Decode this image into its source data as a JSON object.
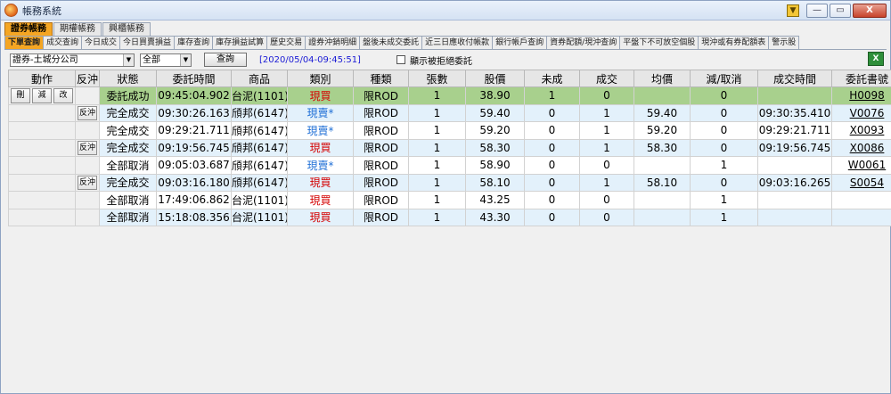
{
  "window": {
    "title": "帳務系統",
    "pin": "▼",
    "minimize": "—",
    "restore": "▭",
    "close": "X"
  },
  "top_tabs": [
    "證券帳務",
    "期權帳務",
    "興櫃帳務"
  ],
  "sub_tabs": [
    "下單查詢",
    "成交查詢",
    "今日成交",
    "今日買賣損益",
    "庫存查詢",
    "庫存損益試算",
    "歷史交易",
    "證券沖銷明細",
    "盤後未成交委託",
    "近三日應收付帳款",
    "銀行帳戶查詢",
    "資券配額/現沖查詢",
    "平盤下不可放空個股",
    "現沖或有券配額表",
    "警示股"
  ],
  "toolbar": {
    "account": "證券-土城分公司",
    "filter": "全部",
    "query_label": "查詢",
    "timestamp": "[2020/05/04-09:45:51]",
    "checkbox_label": "顯示被拒絕委託"
  },
  "excel_icon_label": "X",
  "columns": [
    "動作",
    "反沖",
    "狀態",
    "委託時間",
    "商品",
    "類別",
    "種類",
    "張數",
    "股價",
    "未成",
    "成交",
    "均價",
    "減/取消",
    "成交時間",
    "委託書號"
  ],
  "action_buttons": [
    "刪",
    "減",
    "改"
  ],
  "rows": [
    {
      "actions": true,
      "reverse": "",
      "status": "委託成功",
      "order_time": "09:45:04.902",
      "product": "台泥(1101)",
      "category": "現買",
      "cat_color": "red",
      "kind": "限ROD",
      "lots": "1",
      "price": "38.90",
      "unfilled": "1",
      "filled": "0",
      "avg": "",
      "cancel": "0",
      "fill_time": "",
      "order_no": "H0098",
      "style": "hl"
    },
    {
      "actions": false,
      "reverse": "反沖",
      "status": "完全成交",
      "order_time": "09:30:26.163",
      "product": "頎邦(6147)",
      "category": "現賣*",
      "cat_color": "blue",
      "kind": "限ROD",
      "lots": "1",
      "price": "59.40",
      "unfilled": "0",
      "filled": "1",
      "avg": "59.40",
      "cancel": "0",
      "fill_time": "09:30:35.410",
      "order_no": "V0076",
      "style": "alt"
    },
    {
      "actions": false,
      "reverse": "",
      "status": "完全成交",
      "order_time": "09:29:21.711",
      "product": "頎邦(6147)",
      "category": "現賣*",
      "cat_color": "blue",
      "kind": "限ROD",
      "lots": "1",
      "price": "59.20",
      "unfilled": "0",
      "filled": "1",
      "avg": "59.20",
      "cancel": "0",
      "fill_time": "09:29:21.711",
      "order_no": "X0093",
      "style": "white"
    },
    {
      "actions": false,
      "reverse": "反沖",
      "status": "完全成交",
      "order_time": "09:19:56.745",
      "product": "頎邦(6147)",
      "category": "現買",
      "cat_color": "red",
      "kind": "限ROD",
      "lots": "1",
      "price": "58.30",
      "unfilled": "0",
      "filled": "1",
      "avg": "58.30",
      "cancel": "0",
      "fill_time": "09:19:56.745",
      "order_no": "X0086",
      "style": "alt"
    },
    {
      "actions": false,
      "reverse": "",
      "status": "全部取消",
      "order_time": "09:05:03.687",
      "product": "頎邦(6147)",
      "category": "現賣*",
      "cat_color": "blue",
      "kind": "限ROD",
      "lots": "1",
      "price": "58.90",
      "unfilled": "0",
      "filled": "0",
      "avg": "",
      "cancel": "1",
      "fill_time": "",
      "order_no": "W0061",
      "style": "white"
    },
    {
      "actions": false,
      "reverse": "反沖",
      "status": "完全成交",
      "order_time": "09:03:16.180",
      "product": "頎邦(6147)",
      "category": "現買",
      "cat_color": "red",
      "kind": "限ROD",
      "lots": "1",
      "price": "58.10",
      "unfilled": "0",
      "filled": "1",
      "avg": "58.10",
      "cancel": "0",
      "fill_time": "09:03:16.265",
      "order_no": "S0054",
      "style": "alt"
    },
    {
      "actions": false,
      "reverse": "",
      "status": "全部取消",
      "order_time": "17:49:06.862",
      "product": "台泥(1101)",
      "category": "現買",
      "cat_color": "red",
      "kind": "限ROD",
      "lots": "1",
      "price": "43.25",
      "unfilled": "0",
      "filled": "0",
      "avg": "",
      "cancel": "1",
      "fill_time": "",
      "order_no": "",
      "style": "white"
    },
    {
      "actions": false,
      "reverse": "",
      "status": "全部取消",
      "order_time": "15:18:08.356",
      "product": "台泥(1101)",
      "category": "現買",
      "cat_color": "red",
      "kind": "限ROD",
      "lots": "1",
      "price": "43.30",
      "unfilled": "0",
      "filled": "0",
      "avg": "",
      "cancel": "1",
      "fill_time": "",
      "order_no": "",
      "style": "alt"
    }
  ]
}
